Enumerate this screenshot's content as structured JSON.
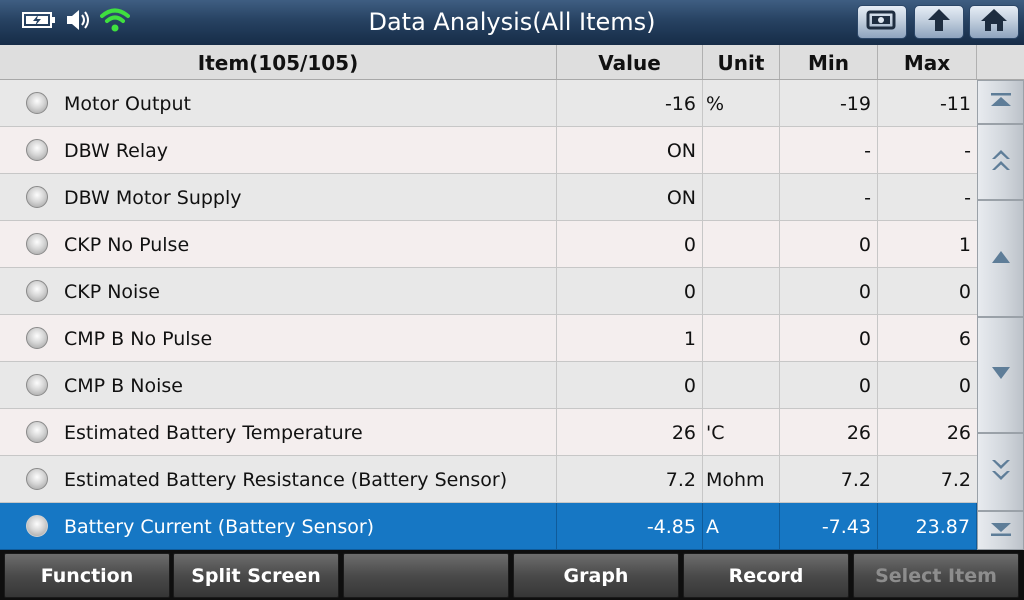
{
  "title": "Data Analysis(All Items)",
  "status_icons": [
    "battery-icon",
    "speaker-icon",
    "wifi-icon"
  ],
  "top_buttons": [
    "screenshot-icon",
    "back-icon",
    "home-icon"
  ],
  "columns": {
    "item": "Item(105/105)",
    "value": "Value",
    "unit": "Unit",
    "min": "Min",
    "max": "Max"
  },
  "rows": [
    {
      "name": "Motor Output",
      "value": "-16",
      "unit": "%",
      "min": "-19",
      "max": "-11",
      "selected": false
    },
    {
      "name": "DBW Relay",
      "value": "ON",
      "unit": "",
      "min": "-",
      "max": "-",
      "selected": false
    },
    {
      "name": "DBW Motor Supply",
      "value": "ON",
      "unit": "",
      "min": "-",
      "max": "-",
      "selected": false
    },
    {
      "name": "CKP No Pulse",
      "value": "0",
      "unit": "",
      "min": "0",
      "max": "1",
      "selected": false
    },
    {
      "name": "CKP Noise",
      "value": "0",
      "unit": "",
      "min": "0",
      "max": "0",
      "selected": false
    },
    {
      "name": "CMP B No Pulse",
      "value": "1",
      "unit": "",
      "min": "0",
      "max": "6",
      "selected": false
    },
    {
      "name": "CMP B Noise",
      "value": "0",
      "unit": "",
      "min": "0",
      "max": "0",
      "selected": false
    },
    {
      "name": "Estimated Battery Temperature",
      "value": "26",
      "unit": "'C",
      "min": "26",
      "max": "26",
      "selected": false
    },
    {
      "name": "Estimated Battery Resistance (Battery Sensor)",
      "value": "7.2",
      "unit": "Mohm",
      "min": "7.2",
      "max": "7.2",
      "selected": false
    },
    {
      "name": "Battery Current (Battery Sensor)",
      "value": "-4.85",
      "unit": "A",
      "min": "-7.43",
      "max": "23.87",
      "selected": true
    }
  ],
  "scroll_buttons": [
    "scroll-top-icon",
    "page-up-icon",
    "line-up-icon",
    "line-down-icon",
    "page-down-icon",
    "scroll-bottom-icon"
  ],
  "toolbar": {
    "function": "Function",
    "split_screen": "Split Screen",
    "empty": "",
    "graph": "Graph",
    "record": "Record",
    "select_item": "Select Item"
  },
  "colors": {
    "title_bar": "#274262",
    "selected_row": "#1677c4",
    "wifi": "#3fe03f"
  }
}
